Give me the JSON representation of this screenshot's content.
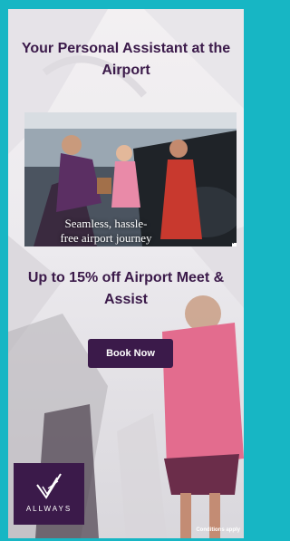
{
  "headline": "Your Personal Assistant at the Airport",
  "video": {
    "caption": "Seamless, hassle-free airport journey",
    "pause_icon": "pause-icon",
    "volume_icon": "volume-icon",
    "replay_icon": "replay-icon"
  },
  "offer": "Up to 15% off Airport Meet & Assist",
  "cta_label": "Book Now",
  "brand": {
    "name": "ALLWAYS",
    "icon": "allways-logo-mark"
  },
  "conditions": "Conditions apply",
  "colors": {
    "frame": "#17b6c4",
    "brand_purple": "#3b1a4a",
    "cta_text": "#ffffff"
  }
}
